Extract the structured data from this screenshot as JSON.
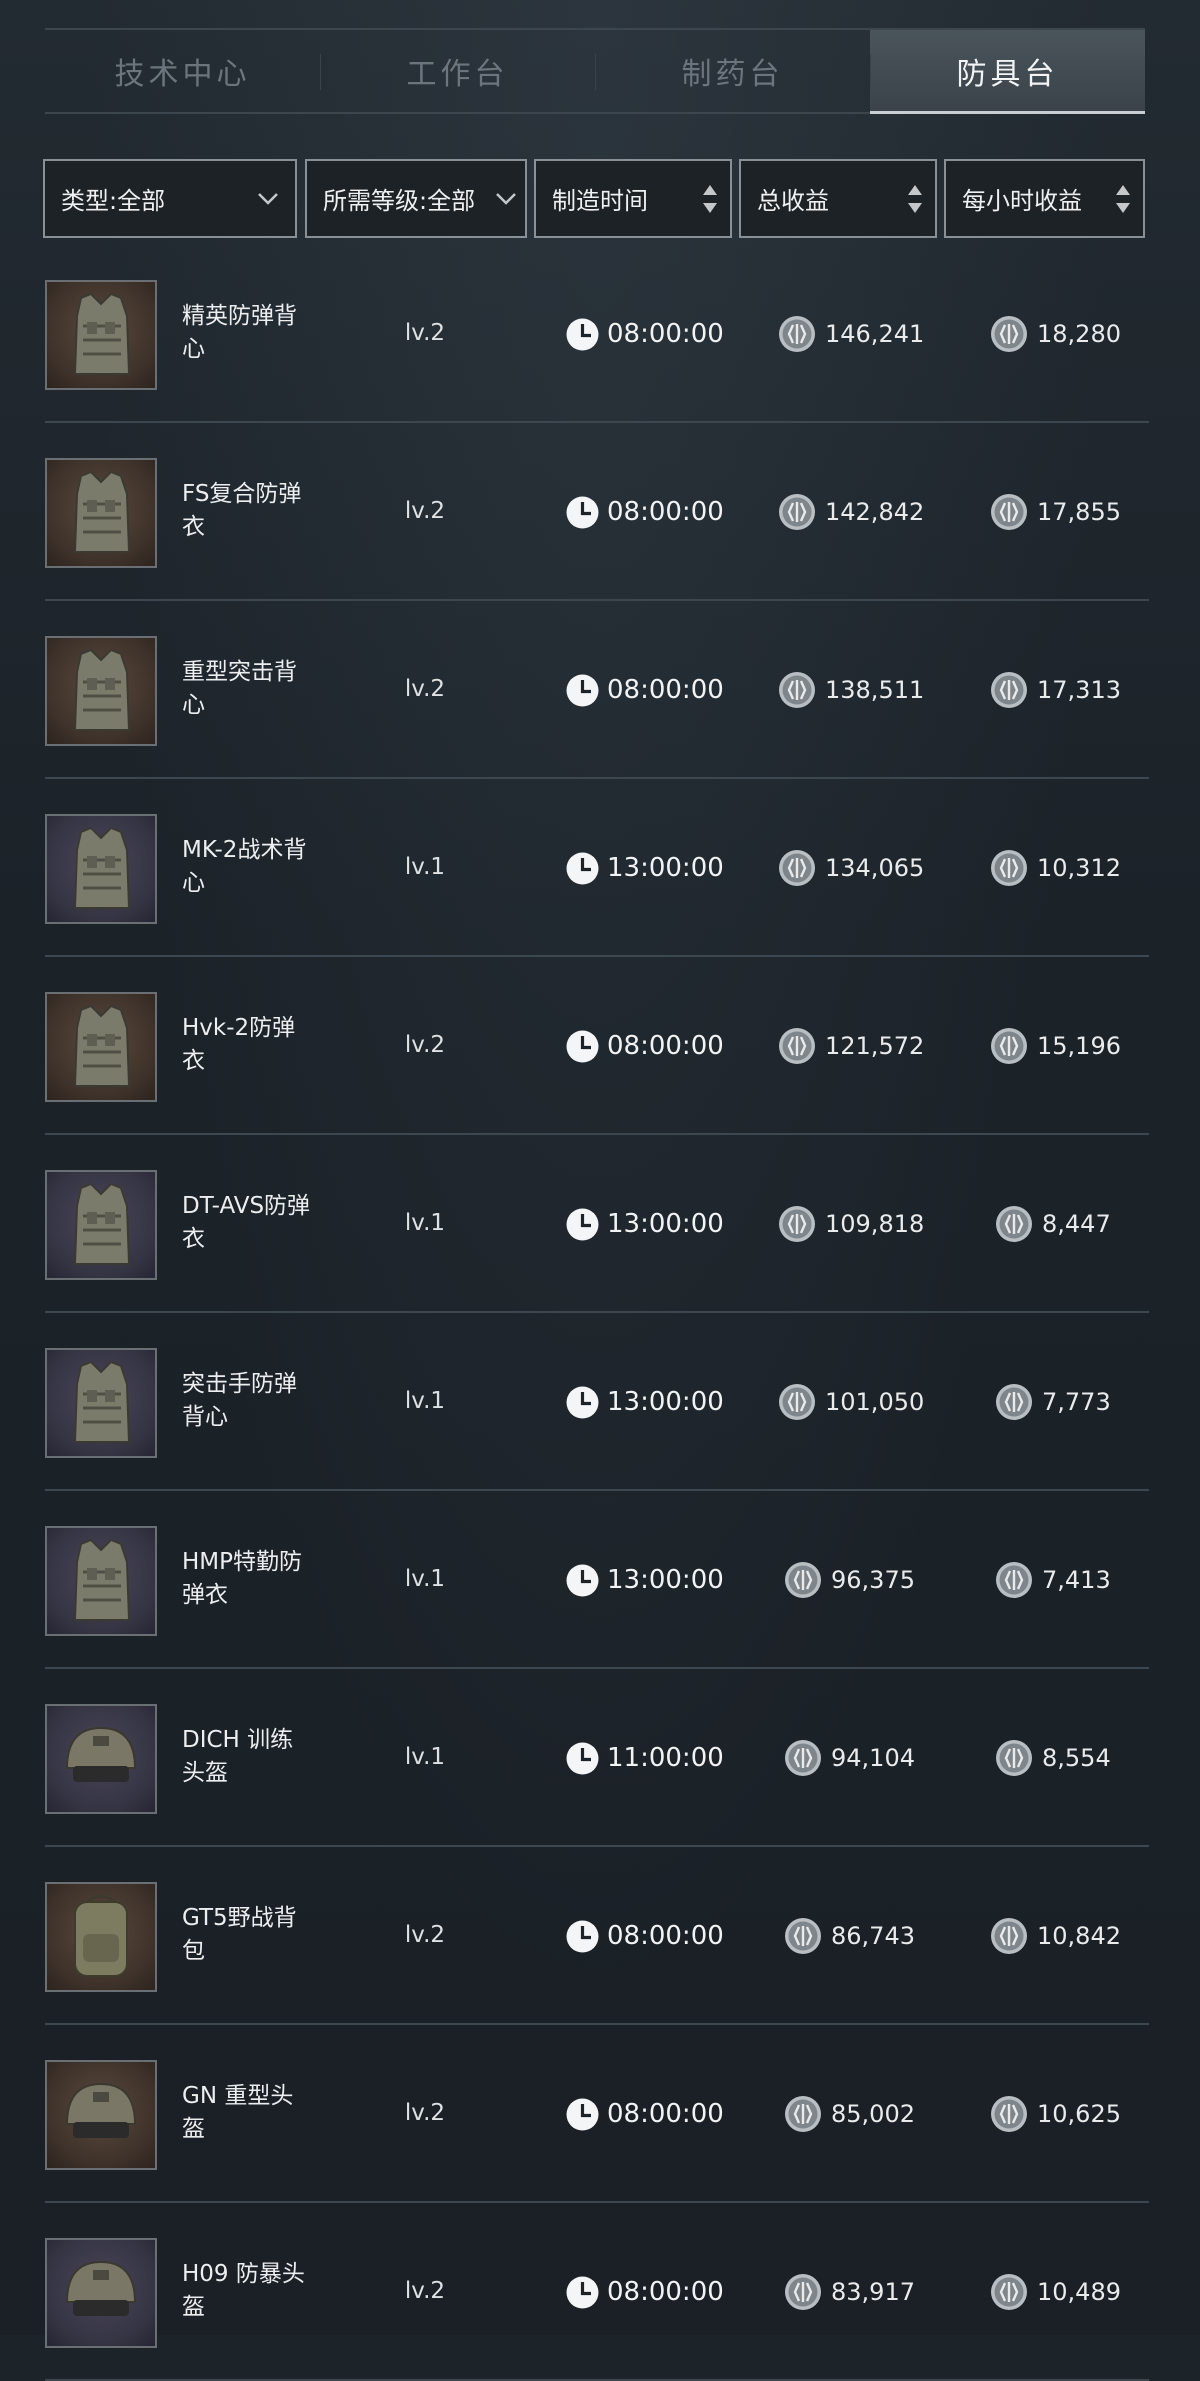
{
  "tabs": [
    {
      "label": "技术中心",
      "active": false
    },
    {
      "label": "工作台",
      "active": false
    },
    {
      "label": "制药台",
      "active": false
    },
    {
      "label": "防具台",
      "active": true
    }
  ],
  "filters": {
    "type": "类型:全部",
    "level": "所需等级:全部",
    "time": "制造时间",
    "total": "总收益",
    "hourly": "每小时收益"
  },
  "items": [
    {
      "name": "精英防弹背心",
      "level": "lv.2",
      "time": "08:00:00",
      "total": "146,241",
      "hourly": "18,280",
      "icon": "vest-icon",
      "bg": "brown"
    },
    {
      "name": "FS复合防弹衣",
      "level": "lv.2",
      "time": "08:00:00",
      "total": "142,842",
      "hourly": "17,855",
      "icon": "vest-icon",
      "bg": "brown"
    },
    {
      "name": "重型突击背心",
      "level": "lv.2",
      "time": "08:00:00",
      "total": "138,511",
      "hourly": "17,313",
      "icon": "vest-icon",
      "bg": "brown"
    },
    {
      "name": "MK-2战术背心",
      "level": "lv.1",
      "time": "13:00:00",
      "total": "134,065",
      "hourly": "10,312",
      "icon": "vest-icon",
      "bg": "purple"
    },
    {
      "name": "Hvk-2防弹衣",
      "level": "lv.2",
      "time": "08:00:00",
      "total": "121,572",
      "hourly": "15,196",
      "icon": "vest-icon",
      "bg": "brown"
    },
    {
      "name": "DT-AVS防弹衣",
      "level": "lv.1",
      "time": "13:00:00",
      "total": "109,818",
      "hourly": "8,447",
      "icon": "vest-icon",
      "bg": "purple"
    },
    {
      "name": "突击手防弹背心",
      "level": "lv.1",
      "time": "13:00:00",
      "total": "101,050",
      "hourly": "7,773",
      "icon": "vest-icon",
      "bg": "purple"
    },
    {
      "name": "HMP特勤防弹衣",
      "level": "lv.1",
      "time": "13:00:00",
      "total": "96,375",
      "hourly": "7,413",
      "icon": "vest-icon",
      "bg": "purple"
    },
    {
      "name": "DICH 训练头盔",
      "level": "lv.1",
      "time": "11:00:00",
      "total": "94,104",
      "hourly": "8,554",
      "icon": "helmet-icon",
      "bg": "purple"
    },
    {
      "name": "GT5野战背包",
      "level": "lv.2",
      "time": "08:00:00",
      "total": "86,743",
      "hourly": "10,842",
      "icon": "backpack-icon",
      "bg": "brown"
    },
    {
      "name": "GN 重型头盔",
      "level": "lv.2",
      "time": "08:00:00",
      "total": "85,002",
      "hourly": "10,625",
      "icon": "helmet-icon",
      "bg": "brown"
    },
    {
      "name": "H09 防暴头盔",
      "level": "lv.2",
      "time": "08:00:00",
      "total": "83,917",
      "hourly": "10,489",
      "icon": "helmet-icon",
      "bg": "purple"
    }
  ],
  "colors": {
    "background": "#1c2329",
    "divider": "#3d474f",
    "active_tab": "#434c53",
    "text": "#e6e8ea"
  }
}
